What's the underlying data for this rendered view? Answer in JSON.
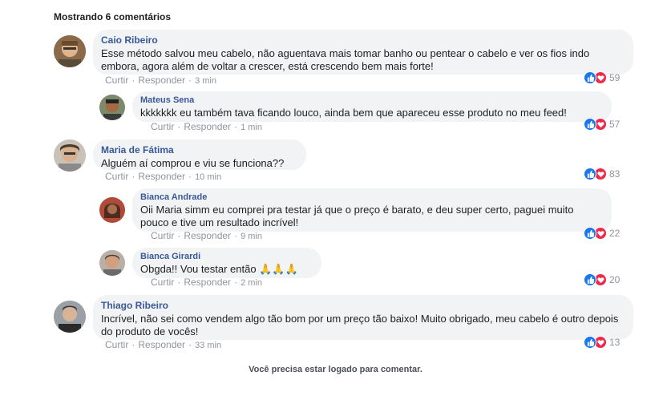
{
  "header": {
    "title": "Mostrando 6 comentários"
  },
  "actions": {
    "like": "Curtir",
    "reply": "Responder",
    "separator": "·"
  },
  "colors": {
    "like": "#1877f2",
    "love": "#f0284a",
    "author": "#385898"
  },
  "comments": [
    {
      "author": "Caio Ribeiro",
      "text": "Esse método salvou meu cabelo, não aguentava mais tomar banho ou pentear o cabelo e ver os fios indo embora, agora além de voltar a crescer, está crescendo bem mais forte!",
      "time": "3 min",
      "reactions": "59"
    },
    {
      "author": "Mateus Sena",
      "text": "kkkkkkk eu também tava ficando louco, ainda bem que apareceu esse produto no meu feed!",
      "time": "1 min",
      "reactions": "57"
    },
    {
      "author": "Maria de Fátima",
      "text": "Alguém aí comprou e viu se funciona??",
      "time": "10 min",
      "reactions": "83"
    },
    {
      "author": "Bianca Andrade",
      "text": "Oii Maria simm eu comprei pra testar já que o preço é barato, e deu super certo, paguei muito pouco e tive um resultado incrível!",
      "time": "9 min",
      "reactions": "22"
    },
    {
      "author": "Bianca Girardi",
      "text": "Obgda!! Vou testar então",
      "emoji": "🙏🙏🙏",
      "time": "2 min",
      "reactions": "20"
    },
    {
      "author": "Thiago Ribeiro",
      "text": "Incrível, não sei como vendem algo tão bom por um preço tão baixo! Muito obrigado, meu cabelo é outro depois do produto de vocês!",
      "time": "33 min",
      "reactions": "13"
    }
  ],
  "footer": {
    "text": "Você precisa estar logado para comentar."
  }
}
